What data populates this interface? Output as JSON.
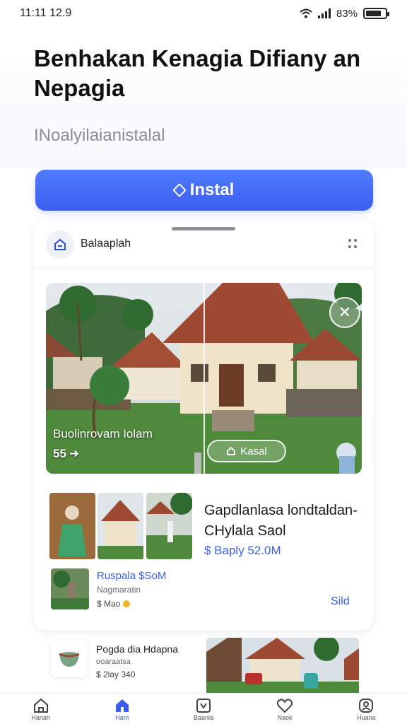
{
  "status_bar": {
    "time": "11:11 12.9",
    "battery_text": "83%",
    "battery_level": 0.8
  },
  "header": {
    "title": "Benhakan Kenagia Difiany an Nepagia",
    "subtitle": "INoalyilaianistalal"
  },
  "install_button": {
    "label": "Instal",
    "icon": "diamond-icon"
  },
  "card": {
    "title": "Balaaplah",
    "feature": {
      "caption": "Buolinrovam Iolam",
      "count": "55",
      "pill_label": "Kasal",
      "pill_icon": "home-icon",
      "close_icon": "close-icon"
    },
    "listing": {
      "title": "Gapdlanlasa londtaldan- CHylala Saol",
      "price": "$ Baply 52.0M"
    },
    "sub_listing": {
      "title": "Ruspala $SoM",
      "subtitle": "Nagmaratin",
      "meta": "$ Mao",
      "action": "Sild"
    }
  },
  "bottom_listing": {
    "title": "Pogda dia Hdapna",
    "subtitle": "ooaraatsa",
    "meta": "$ 2lay 340"
  },
  "nav": {
    "items": [
      {
        "label": "Hanah",
        "icon": "home-icon"
      },
      {
        "label": "Ham",
        "icon": "home-filled-icon",
        "active": true
      },
      {
        "label": "Baania",
        "icon": "map-icon"
      },
      {
        "label": "Naok",
        "icon": "heart-icon"
      },
      {
        "label": "Huana",
        "icon": "profile-icon"
      }
    ]
  },
  "colors": {
    "accent": "#3b5ef0",
    "text": "#111111",
    "muted": "#8a8d94"
  }
}
